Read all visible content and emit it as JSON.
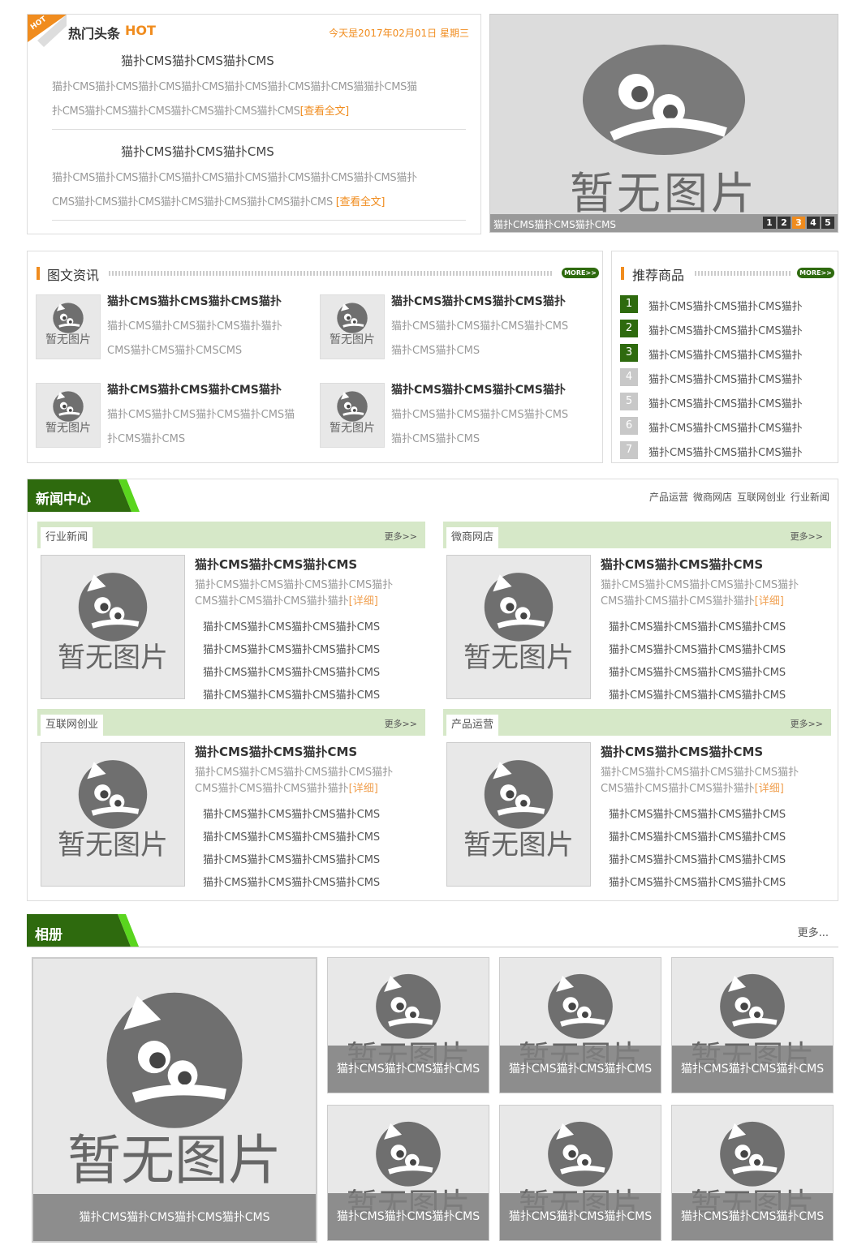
{
  "hot": {
    "badge": "HOT",
    "title": "热门头条",
    "title_hot": "HOT",
    "date": "今天是2017年02月01日 星期三",
    "items": [
      {
        "title": "猫扑CMS猫扑CMS猫扑CMS",
        "line1": "猫扑CMS猫扑CMS猫扑CMS猫扑CMS猫扑CMS猫扑CMS猫扑CMS猫猫扑CMS猫",
        "line2": "扑CMS猫扑CMS猫扑CMS猫扑CMS猫扑CMS猫扑CMS",
        "more": "[查看全文]"
      },
      {
        "title": "猫扑CMS猫扑CMS猫扑CMS",
        "line1": "猫扑CMS猫扑CMS猫扑CMS猫扑CMS猫扑CMS猫扑CMS猫扑CMS猫扑CMS猫扑",
        "line2": "CMS猫扑CMS猫扑CMS猫扑CMS猫扑CMS猫扑CMS猫扑CMS ",
        "more": "[查看全文]"
      }
    ]
  },
  "slider": {
    "no_image": "暂无图片",
    "caption": "猫扑CMS猫扑CMS猫扑CMS",
    "pages": [
      "1",
      "2",
      "3",
      "4",
      "5"
    ],
    "active_page": 3
  },
  "news_pic": {
    "title": "图文资讯",
    "more": "MORE>>",
    "no_image": "暂无图片",
    "items": [
      {
        "title": "猫扑CMS猫扑CMS猫扑CMS猫扑",
        "l1": "猫扑CMS猫扑CMS猫扑CMS猫扑猫扑",
        "l2": "CMS猫扑CMS猫扑CMSCMS"
      },
      {
        "title": "猫扑CMS猫扑CMS猫扑CMS猫扑",
        "l1": "猫扑CMS猫扑CMS猫扑CMS猫扑CMS",
        "l2": "猫扑CMS猫扑CMS"
      },
      {
        "title": "猫扑CMS猫扑CMS猫扑CMS猫扑",
        "l1": "猫扑CMS猫扑CMS猫扑CMS猫扑CMS猫",
        "l2": "扑CMS猫扑CMS"
      },
      {
        "title": "猫扑CMS猫扑CMS猫扑CMS猫扑",
        "l1": "猫扑CMS猫扑CMS猫扑CMS猫扑CMS",
        "l2": "猫扑CMS猫扑CMS"
      }
    ]
  },
  "products": {
    "title": "推荐商品",
    "more": "MORE>>",
    "items": [
      {
        "n": "1",
        "t": "猫扑CMS猫扑CMS猫扑CMS猫扑"
      },
      {
        "n": "2",
        "t": "猫扑CMS猫扑CMS猫扑CMS猫扑"
      },
      {
        "n": "3",
        "t": "猫扑CMS猫扑CMS猫扑CMS猫扑"
      },
      {
        "n": "4",
        "t": "猫扑CMS猫扑CMS猫扑CMS猫扑"
      },
      {
        "n": "5",
        "t": "猫扑CMS猫扑CMS猫扑CMS猫扑"
      },
      {
        "n": "6",
        "t": "猫扑CMS猫扑CMS猫扑CMS猫扑"
      },
      {
        "n": "7",
        "t": "猫扑CMS猫扑CMS猫扑CMS猫扑"
      }
    ],
    "colors": {
      "top": "#2e6a0e",
      "rest": "#c8c8c8"
    }
  },
  "center": {
    "title": "新闻中心",
    "nav": [
      "产品运营",
      "微商网店",
      "互联网创业",
      "行业新闻"
    ],
    "no_image": "暂无图片",
    "blocks": [
      {
        "tab": "行业新闻",
        "more": "更多>>",
        "head": "猫扑CMS猫扑CMS猫扑CMS",
        "d1": "猫扑CMS猫扑CMS猫扑CMS猫扑CMS猫扑",
        "d2": "CMS猫扑CMS猫扑CMS猫扑猫扑",
        "detail": "[详细]",
        "list": [
          "猫扑CMS猫扑CMS猫扑CMS猫扑CMS",
          "猫扑CMS猫扑CMS猫扑CMS猫扑CMS",
          "猫扑CMS猫扑CMS猫扑CMS猫扑CMS",
          "猫扑CMS猫扑CMS猫扑CMS猫扑CMS"
        ]
      },
      {
        "tab": "微商网店",
        "more": "更多>>",
        "head": "猫扑CMS猫扑CMS猫扑CMS",
        "d1": "猫扑CMS猫扑CMS猫扑CMS猫扑CMS猫扑",
        "d2": "CMS猫扑CMS猫扑CMS猫扑猫扑",
        "detail": "[详细]",
        "list": [
          "猫扑CMS猫扑CMS猫扑CMS猫扑CMS",
          "猫扑CMS猫扑CMS猫扑CMS猫扑CMS",
          "猫扑CMS猫扑CMS猫扑CMS猫扑CMS",
          "猫扑CMS猫扑CMS猫扑CMS猫扑CMS"
        ]
      },
      {
        "tab": "互联网创业",
        "more": "更多>>",
        "head": "猫扑CMS猫扑CMS猫扑CMS",
        "d1": "猫扑CMS猫扑CMS猫扑CMS猫扑CMS猫扑",
        "d2": "CMS猫扑CMS猫扑CMS猫扑猫扑",
        "detail": "[详细]",
        "list": [
          "猫扑CMS猫扑CMS猫扑CMS猫扑CMS",
          "猫扑CMS猫扑CMS猫扑CMS猫扑CMS",
          "猫扑CMS猫扑CMS猫扑CMS猫扑CMS",
          "猫扑CMS猫扑CMS猫扑CMS猫扑CMS"
        ]
      },
      {
        "tab": "产品运营",
        "more": "更多>>",
        "head": "猫扑CMS猫扑CMS猫扑CMS",
        "d1": "猫扑CMS猫扑CMS猫扑CMS猫扑CMS猫扑",
        "d2": "CMS猫扑CMS猫扑CMS猫扑猫扑",
        "detail": "[详细]",
        "list": [
          "猫扑CMS猫扑CMS猫扑CMS猫扑CMS",
          "猫扑CMS猫扑CMS猫扑CMS猫扑CMS",
          "猫扑CMS猫扑CMS猫扑CMS猫扑CMS",
          "猫扑CMS猫扑CMS猫扑CMS猫扑CMS"
        ]
      }
    ]
  },
  "album": {
    "title": "相册",
    "more": "更多...",
    "no_image": "暂无图片",
    "big_caption": "猫扑CMS猫扑CMS猫扑CMS猫扑CMS",
    "captions": [
      "猫扑CMS猫扑CMS猫扑CMS",
      "猫扑CMS猫扑CMS猫扑CMS",
      "猫扑CMS猫扑CMS猫扑CMS",
      "猫扑CMS猫扑CMS猫扑CMS",
      "猫扑CMS猫扑CMS猫扑CMS",
      "猫扑CMS猫扑CMS猫扑CMS"
    ]
  },
  "colors": {
    "green": "#2e6a0e",
    "lime": "#5ad51e",
    "orange": "#f08c1e",
    "light_green": "#d6e8c8"
  }
}
